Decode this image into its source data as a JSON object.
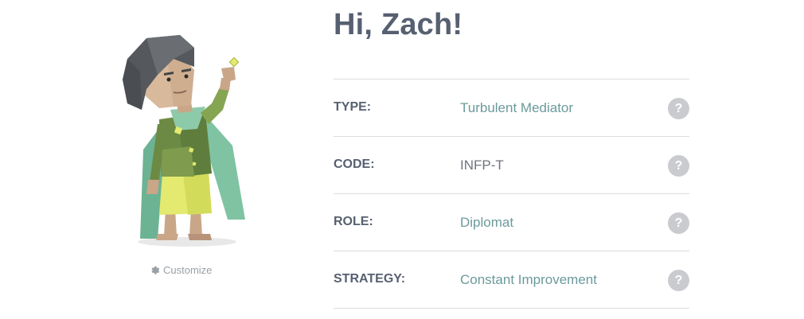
{
  "profile": {
    "greeting": "Hi, Zach!",
    "customize_label": "Customize"
  },
  "traits": [
    {
      "label": "TYPE:",
      "value": "Turbulent Mediator",
      "value_style": "link"
    },
    {
      "label": "CODE:",
      "value": "INFP-T",
      "value_style": "plain"
    },
    {
      "label": "ROLE:",
      "value": "Diplomat",
      "value_style": "link"
    },
    {
      "label": "STRATEGY:",
      "value": "Constant Improvement",
      "value_style": "link"
    }
  ],
  "help_glyph": "?",
  "icons": {
    "customize": "gear-icon",
    "help": "question-icon",
    "avatar": "diplomat-avatar-illustration"
  },
  "colors": {
    "heading": "#576071",
    "link_value": "#6b9a9b",
    "plain_value": "#6e737b",
    "help_circle": "#c9cbcf",
    "divider": "#dddddd",
    "muted": "#9aa0a6"
  }
}
